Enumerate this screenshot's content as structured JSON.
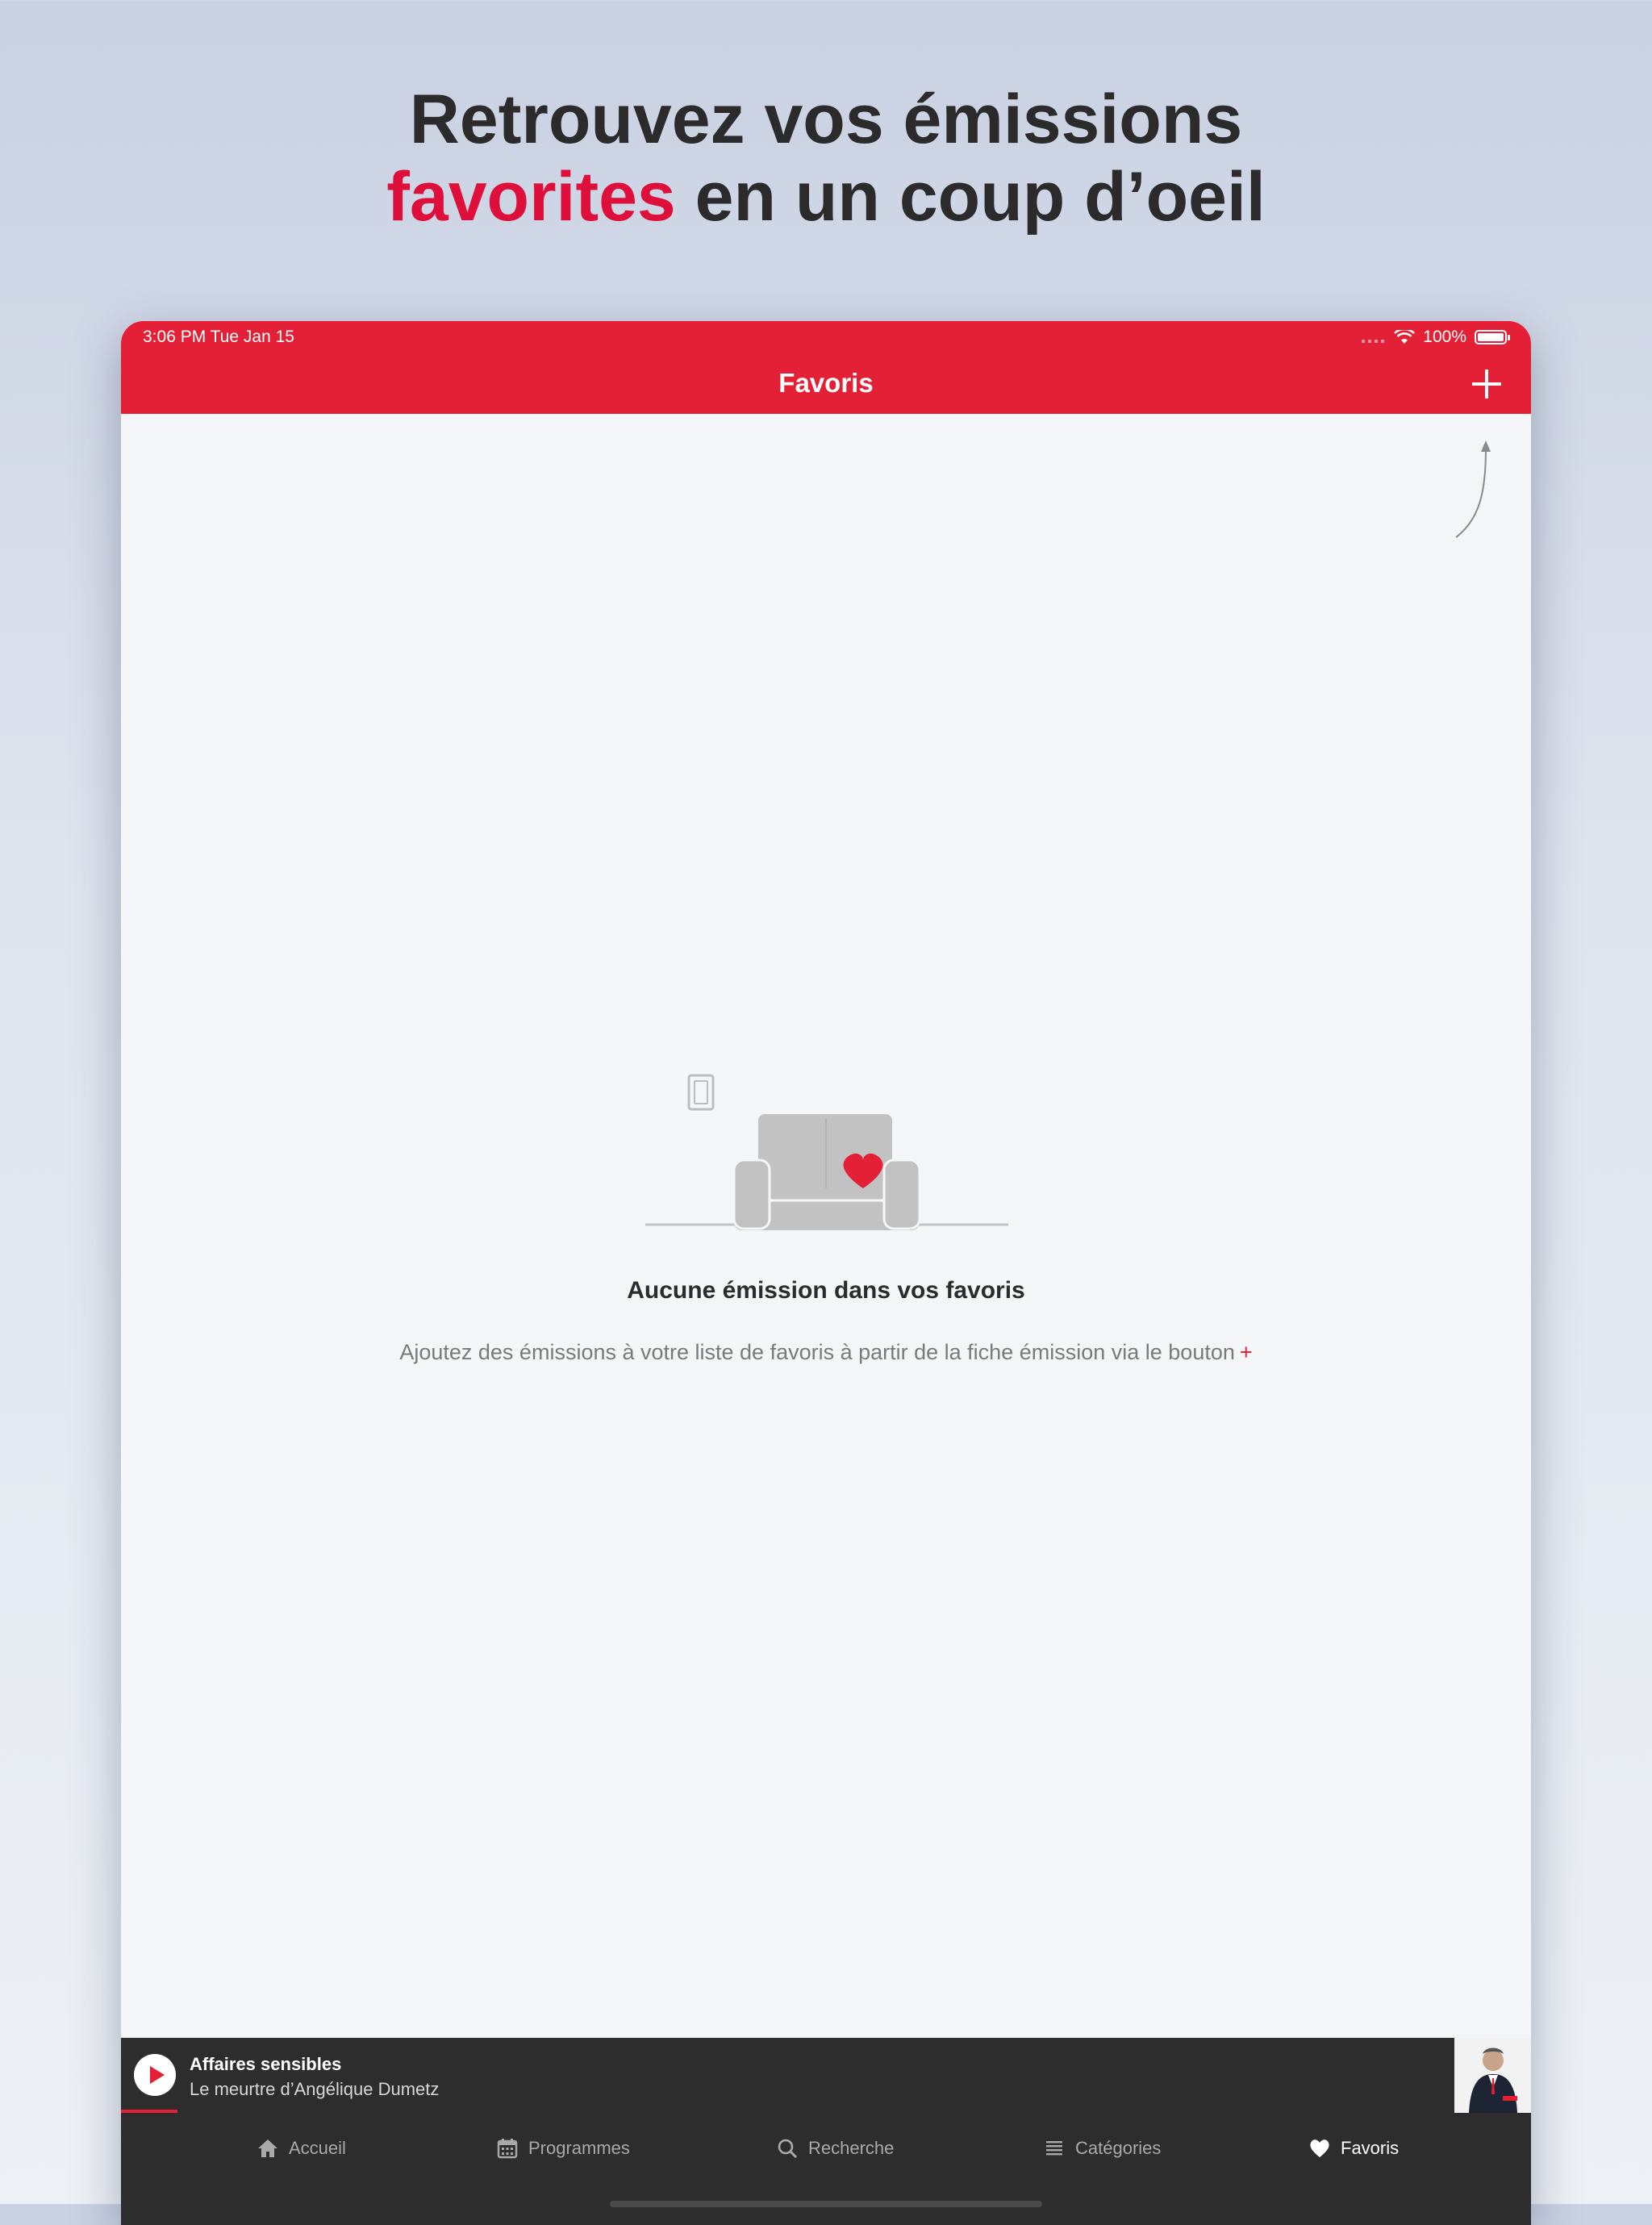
{
  "headline": {
    "line1": "Retrouvez vos émissions",
    "accent": "favorites",
    "rest": " en un coup d’oeil"
  },
  "status_bar": {
    "time": "3:06 PM   Tue Jan 15",
    "battery": "100%"
  },
  "nav": {
    "title": "Favoris",
    "add_icon": "plus-icon"
  },
  "empty_state": {
    "title": "Aucune émission dans vos favoris",
    "description": "Ajoutez des émissions à votre liste de favoris à partir de la fiche émission via le bouton",
    "plus_symbol": "+"
  },
  "player": {
    "title": "Affaires sensibles",
    "subtitle": "Le meurtre d’Angélique Dumetz"
  },
  "tabs": [
    {
      "label": "Accueil",
      "icon": "home-icon"
    },
    {
      "label": "Programmes",
      "icon": "calendar-icon"
    },
    {
      "label": "Recherche",
      "icon": "search-icon"
    },
    {
      "label": "Catégories",
      "icon": "list-icon"
    },
    {
      "label": "Favoris",
      "icon": "heart-icon",
      "active": true
    }
  ],
  "colors": {
    "brand_red": "#e32035",
    "headline_accent": "#de0f3a",
    "player_bg": "#2d2d2d"
  }
}
